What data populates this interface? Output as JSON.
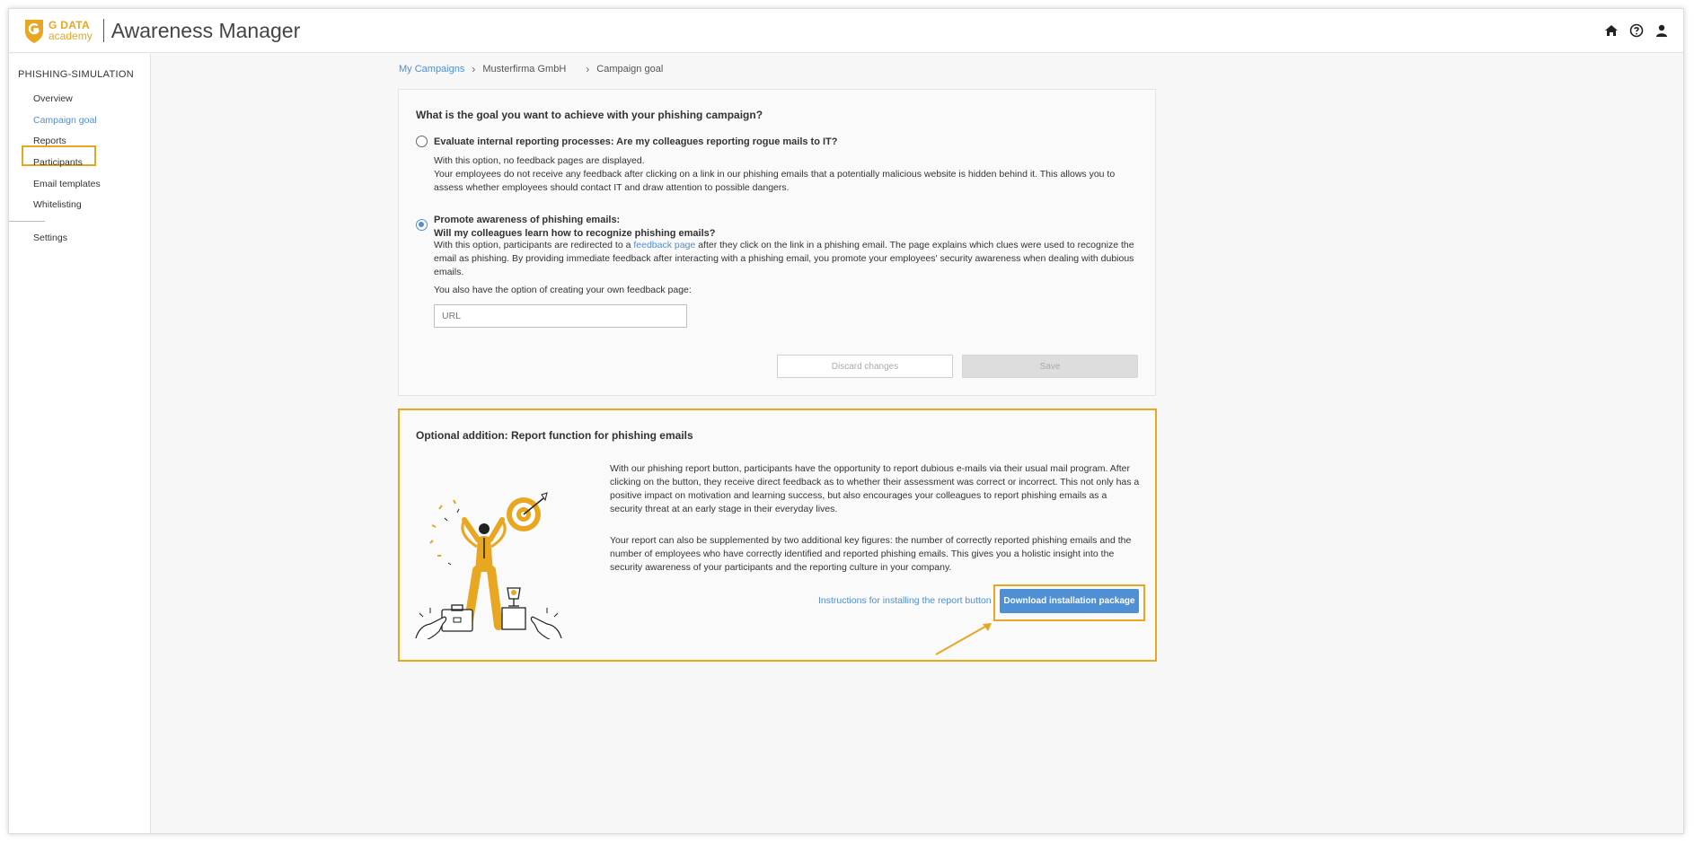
{
  "header": {
    "logo_line1": "G DATA",
    "logo_line2": "academy",
    "app_title": "Awareness Manager",
    "icons": [
      "home-icon",
      "help-icon",
      "user-icon"
    ]
  },
  "sidebar": {
    "section_title": "PHISHING-SIMULATION",
    "items": [
      {
        "label": "Overview"
      },
      {
        "label": "Campaign goal",
        "active": true
      },
      {
        "label": "Reports"
      },
      {
        "label": "Participants"
      },
      {
        "label": "Email templates"
      },
      {
        "label": "Whitelisting"
      }
    ],
    "settings_label": "Settings"
  },
  "breadcrumb": {
    "item1": "My Campaigns",
    "item2": "Musterfirma GmbH",
    "item3": "Campaign goal"
  },
  "goal_card": {
    "question": "What is the goal you want to achieve with your phishing campaign?",
    "option1": {
      "title": "Evaluate internal reporting processes: Are my colleagues reporting rogue mails to IT?",
      "line1": "With this option, no feedback pages are displayed.",
      "line2": "Your employees do not receive any feedback after clicking on a link in our phishing emails that a potentially malicious website is hidden behind it. This allows you to assess whether employees should contact IT and draw attention to possible dangers.",
      "selected": false
    },
    "option2": {
      "title_line1": "Promote awareness of phishing emails:",
      "title_line2": "Will my colleagues learn how to recognize phishing emails?",
      "text_before_link": "With this option, participants are redirected to a ",
      "link_text": "feedback page",
      "text_after_link": " after they click on the link in a phishing email. The page explains which clues were used to recognize the email as phishing. By providing immediate feedback after interacting with a phishing email, you promote your employees' security awareness when dealing with dubious emails.",
      "selected": true
    },
    "own_page_label": "You also have the option of creating your own feedback page:",
    "url_placeholder": "URL",
    "url_value": "",
    "discard_label": "Discard changes",
    "save_label": "Save"
  },
  "report_card": {
    "title": "Optional addition: Report function for phishing emails",
    "paragraph1": "With our phishing report button, participants have the opportunity to report dubious e-mails via their usual mail program. After clicking on the button, they receive direct feedback as to whether their assessment was correct or incorrect. This not only has a positive impact on motivation and learning success, but also encourages your colleagues to report phishing emails as a security threat at an early stage in their everyday lives.",
    "paragraph2": "Your report can also be supplemented by two additional key figures: the number of correctly reported phishing emails and the number of employees who have correctly identified and reported phishing emails. This gives you a holistic insight into the security awareness of your participants and the reporting culture in your company.",
    "instructions_link": "Instructions for installing the report button",
    "download_label": "Download installation package"
  },
  "colors": {
    "accent_orange": "#e9a621",
    "link_blue": "#4f8fd4",
    "button_blue": "#4f8fd4"
  }
}
